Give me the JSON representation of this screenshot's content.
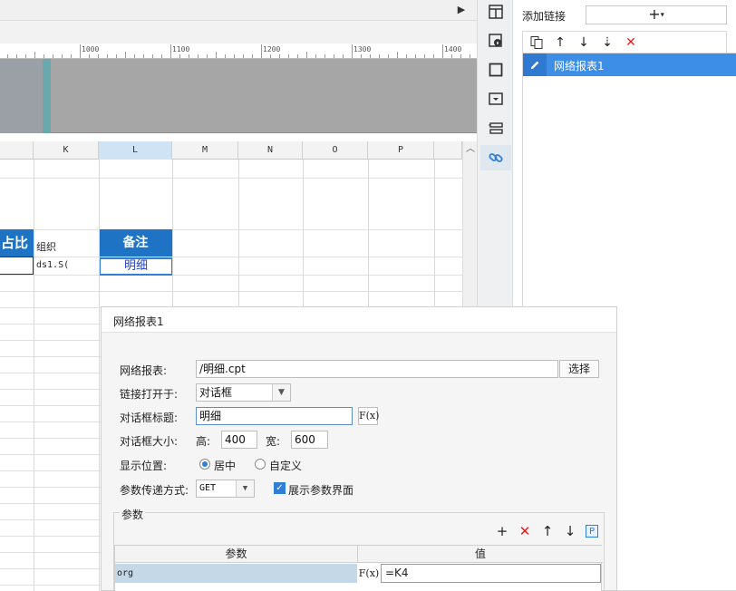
{
  "designer": {
    "ruler_labels": [
      "1000",
      "1100",
      "1200",
      "1300",
      "1400"
    ],
    "columns": [
      "K",
      "L",
      "M",
      "N",
      "O",
      "P"
    ],
    "selected_column": "L",
    "cells": {
      "zhanbi": "占比",
      "zuzhi": "组织",
      "beizhu": "备注",
      "ds1": "ds1.S(",
      "mingxi": "明细"
    }
  },
  "side_icons": [
    "columns-layout-icon",
    "cell-info-icon",
    "square-icon",
    "dropdown-box-icon",
    "list-form-icon",
    "link-icon"
  ],
  "link_panel": {
    "title": "添加链接",
    "add_glyph": "+",
    "add_arrow": "▾",
    "items": [
      {
        "label": "网络报表1"
      }
    ]
  },
  "dialog": {
    "title": "网络报表1",
    "report_label": "网络报表:",
    "report_value": "/明细.cpt",
    "select_button": "选择",
    "open_in_label": "链接打开于:",
    "open_in_value": "对话框",
    "dialog_title_label": "对话框标题:",
    "dialog_title_value": "明细",
    "fx_label": "F(x)",
    "size_label": "对话框大小:",
    "height_label": "高:",
    "height_value": "400",
    "width_label": "宽:",
    "width_value": "600",
    "position_label": "显示位置:",
    "position_options": [
      "居中",
      "自定义"
    ],
    "position_selected": "居中",
    "method_label": "参数传递方式:",
    "method_value": "GET",
    "show_params_label": "展示参数界面",
    "show_params_checked": true,
    "params_title": "参数",
    "params_table": {
      "headers": [
        "参数",
        "值"
      ],
      "rows": [
        {
          "name": "org",
          "fx": "F(x)",
          "value": "=K4"
        }
      ]
    }
  }
}
